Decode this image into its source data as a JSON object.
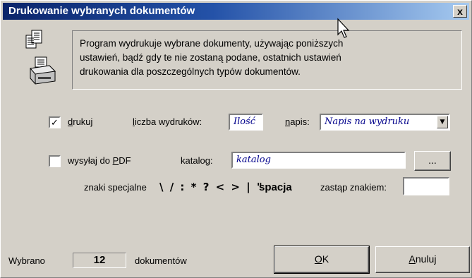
{
  "window": {
    "title": "Drukowanie wybranych dokumentów",
    "close_glyph": "x"
  },
  "info": {
    "text": "Program wydrukuje wybrane dokumenty, używając poniższych\nustawień, bądź gdy te nie zostaną podane, ostatnich ustawień\ndrukowania dla poszczególnych typów dokumentów."
  },
  "print": {
    "checkbox_checked": true,
    "label_pre": "",
    "label_ul": "d",
    "label_post": "rukuj",
    "copies_label_pre": "",
    "copies_label_ul": "l",
    "copies_label_post": "iczba wydruków:",
    "copies_value": "Ilość",
    "caption_label_pre": "",
    "caption_label_ul": "n",
    "caption_label_post": "apis:",
    "caption_value": "Napis na wydruku",
    "dropdown_arrow": "▼"
  },
  "pdf": {
    "checkbox_checked": false,
    "label_pre": "wysyłaj do ",
    "label_ul": "P",
    "label_post": "DF",
    "folder_label": "katalog:",
    "folder_value": "katalog",
    "browse_label": "...",
    "special_label": "znaki specjalne",
    "special_chars": "\\ / : * ? < > | \"",
    "space_label": "spacja",
    "replace_label": "zastąp znakiem:",
    "replace_value": ""
  },
  "footer": {
    "selected_label": "Wybrano",
    "count": "12",
    "documents_label": "dokumentów",
    "ok_ul": "O",
    "ok_post": "K",
    "cancel_ul": "A",
    "cancel_post": "nuluj"
  }
}
